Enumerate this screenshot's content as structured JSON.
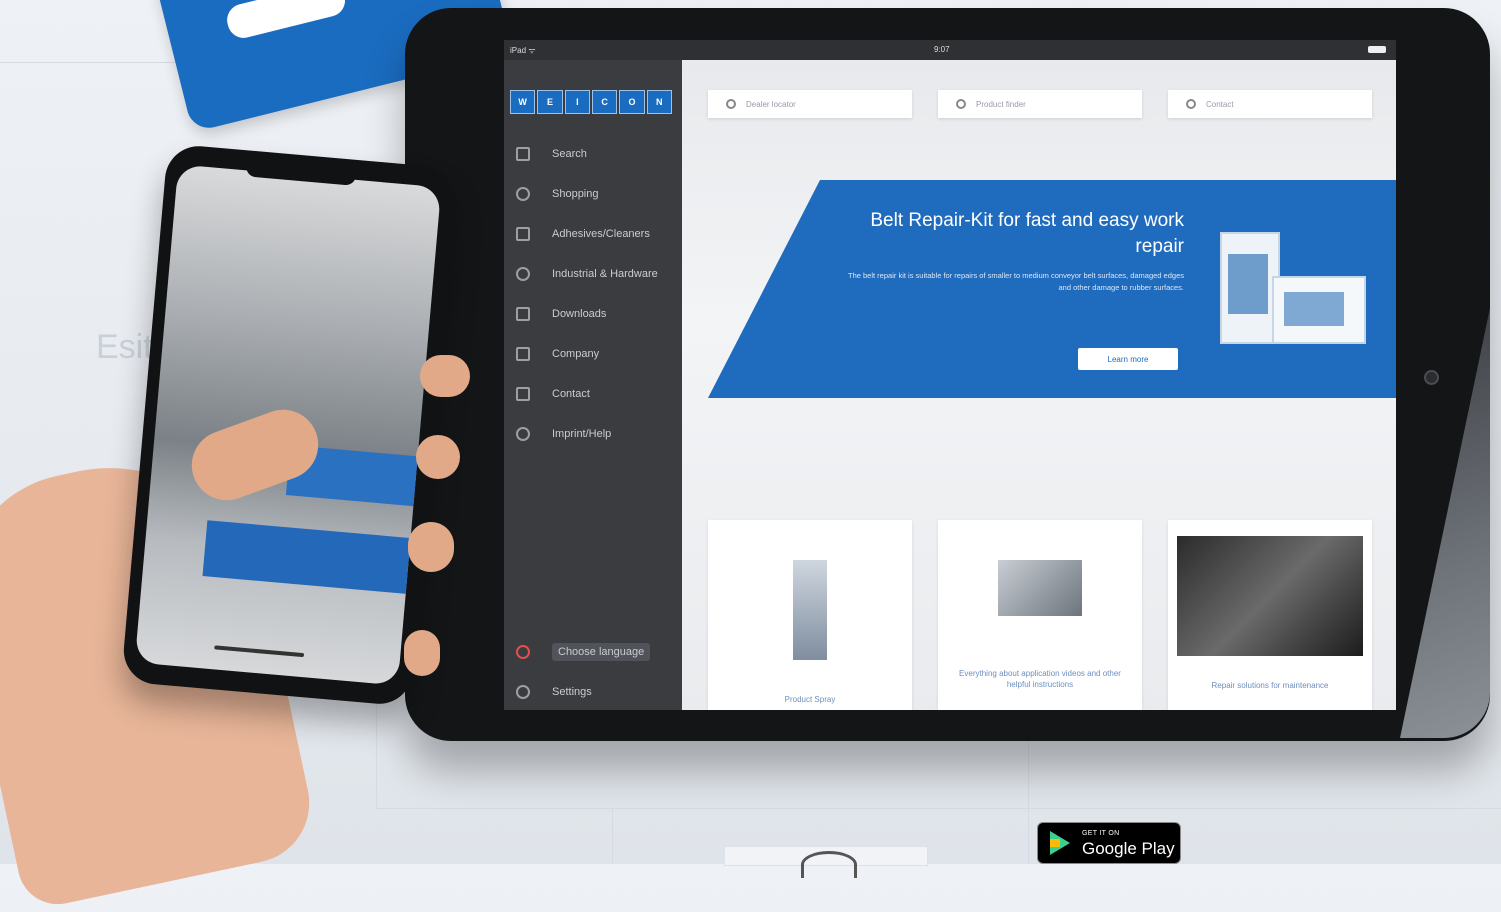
{
  "background": {
    "watermark_text": "Esit"
  },
  "tablet": {
    "status": {
      "left": "iPad ᯤ",
      "time": "9:07"
    },
    "sidebar": {
      "logo_letters": [
        "W",
        "E",
        "I",
        "C",
        "O",
        "N"
      ],
      "items": [
        {
          "icon": "search-icon",
          "label": "Search"
        },
        {
          "icon": "map-pin-icon",
          "label": "Shopping"
        },
        {
          "icon": "layers-icon",
          "label": "Adhesives/Cleaners"
        },
        {
          "icon": "tools-icon",
          "label": "Industrial & Hardware"
        },
        {
          "icon": "document-icon",
          "label": "Downloads"
        },
        {
          "icon": "building-icon",
          "label": "Company"
        },
        {
          "icon": "mail-icon",
          "label": "Contact"
        },
        {
          "icon": "info-icon",
          "label": "Imprint/Help"
        }
      ],
      "bottom_items": [
        {
          "icon": "flag-icon",
          "label": "Choose language",
          "highlight": true
        },
        {
          "icon": "gear-icon",
          "label": "Settings"
        }
      ]
    },
    "top_cards": [
      {
        "icon": "map-pin-icon",
        "label": "Dealer locator"
      },
      {
        "icon": "map-pin-icon",
        "label": "Product finder"
      },
      {
        "icon": "eye-icon",
        "label": "Contact"
      }
    ],
    "banner": {
      "title": "Belt Repair-Kit for fast and easy work repair",
      "description": "The belt repair kit is suitable for repairs of smaller to medium conveyor belt surfaces, damaged edges and other damage to rubber surfaces.",
      "button_label": "Learn more"
    },
    "cards": [
      {
        "caption": "Product Spray"
      },
      {
        "caption": "Everything about application videos and other helpful instructions"
      },
      {
        "caption": "Repair solutions for maintenance"
      }
    ]
  },
  "store_badge": {
    "small": "GET IT ON",
    "big": "Google Play"
  },
  "colors": {
    "brand_blue": "#1f6bbd",
    "sidebar": "#3a3c40",
    "google_green": "#3ccf8e"
  }
}
